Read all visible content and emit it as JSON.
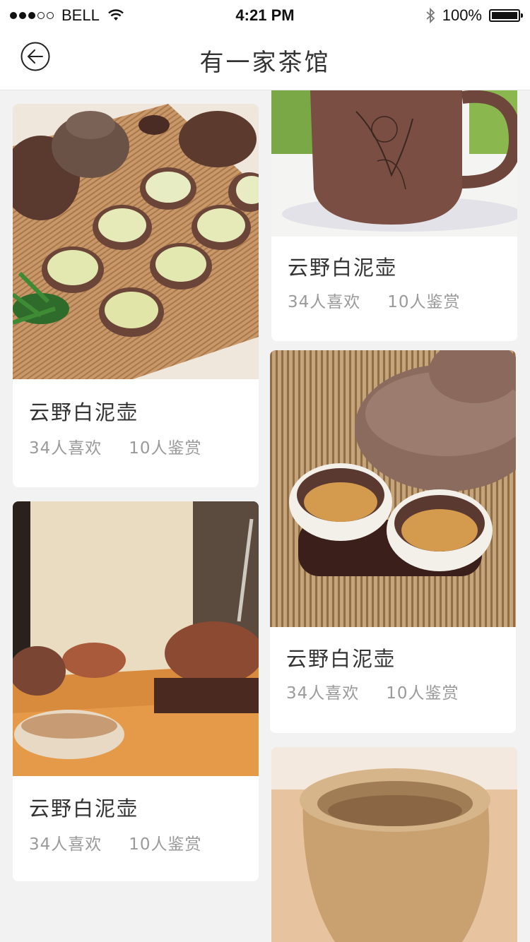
{
  "status_bar": {
    "carrier": "BELL",
    "time": "4:21 PM",
    "battery": "100%"
  },
  "nav": {
    "title": "有一家茶馆"
  },
  "cards": [
    {
      "title": "云野白泥壶",
      "likes": "34人喜欢",
      "views": "10人鉴赏"
    },
    {
      "title": "云野白泥壶",
      "likes": "34人喜欢",
      "views": "10人鉴赏"
    },
    {
      "title": "云野白泥壶",
      "likes": "34人喜欢",
      "views": "10人鉴赏"
    },
    {
      "title": "云野白泥壶",
      "likes": "34人喜欢",
      "views": "10人鉴赏"
    }
  ]
}
